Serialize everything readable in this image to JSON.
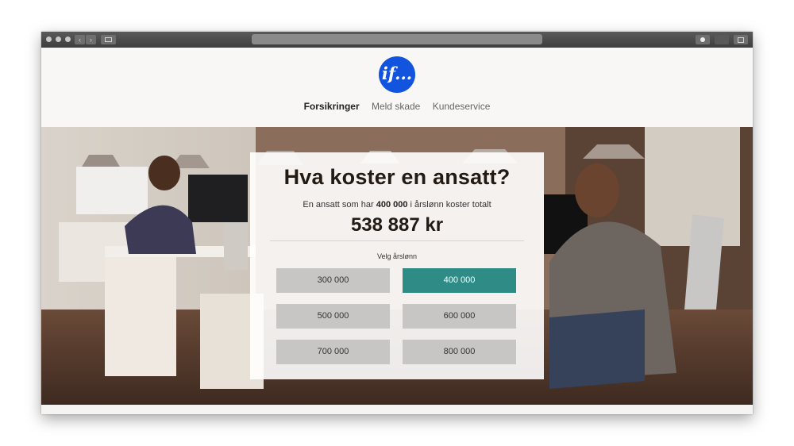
{
  "site": {
    "logo_text": "if...",
    "nav": [
      {
        "label": "Forsikringer",
        "active": true
      },
      {
        "label": "Meld skade",
        "active": false
      },
      {
        "label": "Kundeservice",
        "active": false
      }
    ]
  },
  "calculator": {
    "title": "Hva koster en ansatt?",
    "subtitle_prefix": "En ansatt som har",
    "selected_salary": "400 000",
    "subtitle_suffix": "i årslønn koster totalt",
    "total": "538 887 kr",
    "select_label": "Velg årslønn",
    "options": [
      "300 000",
      "400 000",
      "500 000",
      "600 000",
      "700 000",
      "800 000"
    ],
    "selected_index": 1
  },
  "colors": {
    "brand_blue": "#1254dd",
    "accent_teal": "#2f8b85",
    "option_bg": "#c8c6c4"
  },
  "icons": {
    "window_controls": "traffic-light-dots",
    "back": "chevron-left-icon",
    "forward": "chevron-right-icon",
    "sidebar": "sidebar-icon",
    "download": "download-icon",
    "share": "share-icon",
    "tabs": "tabs-icon"
  }
}
